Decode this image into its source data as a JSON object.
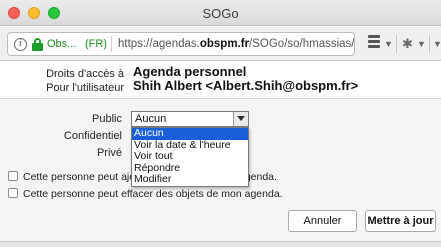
{
  "window": {
    "title": "SOGo"
  },
  "address_bar": {
    "org": "Obs...",
    "country": "(FR)",
    "url_prefix": "https://agendas.",
    "url_domain": "obspm.fr",
    "url_suffix": "/SOGo/so/hmassias/Cale"
  },
  "header": {
    "rights_label_line1": "Droits d'accès à",
    "rights_label_line2": "Pour l'utilisateur",
    "calendar_name": "Agenda personnel",
    "user": "Shih Albert <Albert.Shih@obspm.fr>"
  },
  "form": {
    "public_label": "Public",
    "confidential_label": "Confidentiel",
    "private_label": "Privé",
    "public_value": "Aucun",
    "options": [
      "Aucun",
      "Voir la date & l'heure",
      "Voir tout",
      "Répondre",
      "Modifier"
    ],
    "checkbox_create": "Cette personne peut ajouter des objets à mon agenda.",
    "checkbox_delete": "Cette personne peut effacer des objets de mon agenda."
  },
  "buttons": {
    "cancel": "Annuler",
    "update": "Mettre à jour"
  },
  "colors": {
    "selection": "#1b5fd6",
    "secure": "#1e9c2c"
  }
}
